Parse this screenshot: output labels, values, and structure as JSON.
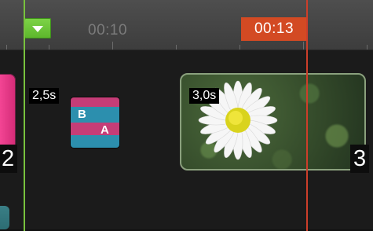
{
  "ruler": {
    "time_label": "00:10",
    "current_time": "00:13"
  },
  "track": {
    "transitions": [
      {
        "duration": "2,5s",
        "icon_letters": [
          "B",
          "A"
        ]
      },
      {
        "duration": "3,0s"
      }
    ],
    "clip_numbers": [
      "2",
      "3"
    ]
  },
  "colors": {
    "playhead": "#cc3e2a",
    "marker": "#78c23d",
    "clip_pink": "#c53d77",
    "clip_blue": "#2c8fae"
  },
  "icons": {
    "marker_button": "triangle-down-icon",
    "transition": "transition-icon",
    "photo": "daisy-photo"
  }
}
